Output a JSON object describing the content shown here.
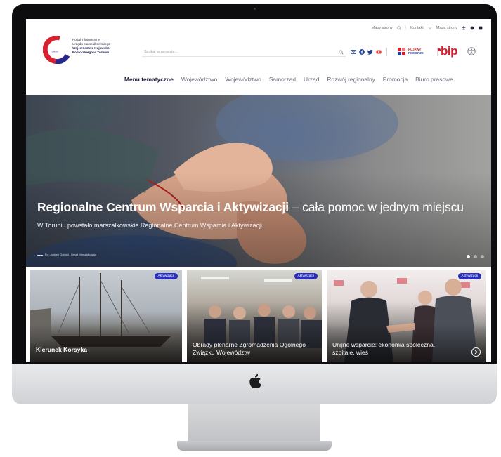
{
  "utility_bar": {
    "links": [
      "Mapy strony",
      "Kontakt",
      "Mapa strony"
    ]
  },
  "logo": {
    "line1": "Portal informacyjny",
    "line2": "Urzędu Marszałkowskiego",
    "line3": "Województwa Kujawsko –",
    "line4": "Pomorskiego w Toruniu"
  },
  "search": {
    "placeholder": "Szukaj w serwisie..."
  },
  "partner": {
    "line1": "KUJAWY",
    "line2": "POMORZE",
    "bip": "bip"
  },
  "nav": {
    "items": [
      "Menu tematyczne",
      "Województwo",
      "Województwo",
      "Samorząd",
      "Urząd",
      "Rozwój regionalny",
      "Promocja",
      "Biuro prasowe"
    ]
  },
  "hero": {
    "title_bold": "Regionalne Centrum Wsparcia i Aktywizacji",
    "title_rest": " – cała pomoc w jednym miejscu",
    "lead": "W Toruniu powstało marszałkowskie Regionalne Centrum Wsparcia i Aktywizacji.",
    "credit": "Fot. Andrzej Goiński / Urząd Marszałkowski",
    "slides_total": 3,
    "slide_active": 1
  },
  "cards": [
    {
      "badge": "Aktywizacji",
      "title": "Kierunek Korsyka"
    },
    {
      "badge": "Aktywizacji",
      "title": "Obrady plenarne Zgromadzenia Ogólnego Związku Województw"
    },
    {
      "badge": "Aktywizacji",
      "title": "Unijne wsparcie: ekonomia społeczna, szpitale, wieś"
    }
  ],
  "colors": {
    "accent_blue": "#2b2fb8",
    "bip_red": "#d41b2c",
    "hero_text": "#ffffff"
  },
  "icons": [
    "search-icon",
    "facebook-icon",
    "twitter-icon",
    "youtube-icon",
    "email-icon",
    "accessibility-icon",
    "arrow-right-icon",
    "apple-logo-icon"
  ]
}
